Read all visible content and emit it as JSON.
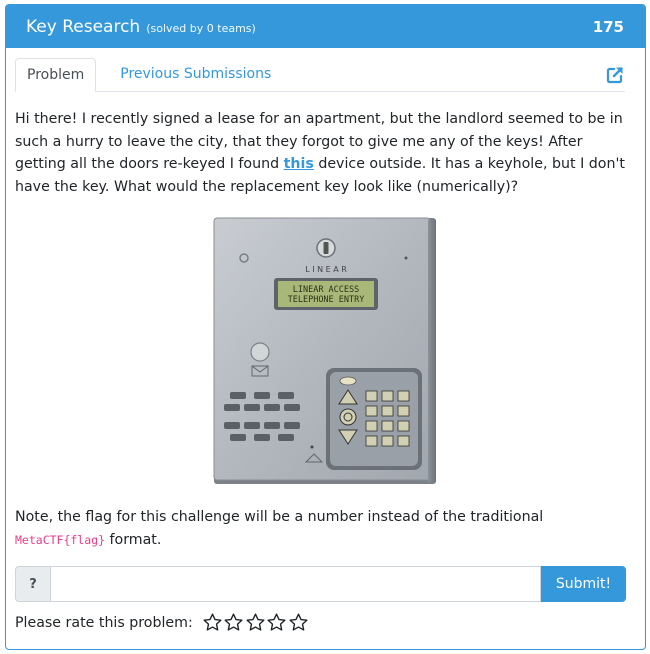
{
  "header": {
    "title": "Key Research",
    "solved": "(solved by 0 teams)",
    "points": "175"
  },
  "tabs": [
    {
      "label": "Problem"
    },
    {
      "label": "Previous Submissions"
    }
  ],
  "description": {
    "part1": "Hi there! I recently signed a lease for an apartment, but the landlord seemed to be in such a hurry to leave the city, that they forgot to give me any of the keys! After getting all the doors re-keyed I found ",
    "link_text": "this",
    "part2": " device outside. It has a keyhole, but I don't have the key. What would the replacement key look like (numerically)?"
  },
  "device_image": {
    "brand": "L I N E A R",
    "lcd_line1": "LINEAR ACCESS",
    "lcd_line2": "TELEPHONE ENTRY"
  },
  "note": {
    "prefix": "Note, the flag for this challenge will be a number instead of the traditional",
    "code": "MetaCTF{flag}",
    "suffix": " format."
  },
  "flag_form": {
    "addon": "?",
    "value": "",
    "placeholder": "",
    "submit_label": "Submit!"
  },
  "rating": {
    "label": "Please rate this problem:",
    "stars": 5,
    "selected": 0
  },
  "colors": {
    "primary": "#3498db",
    "code": "#e83e8c"
  },
  "icons": {
    "external_link": "external-link-icon",
    "star": "star-outline-icon"
  }
}
